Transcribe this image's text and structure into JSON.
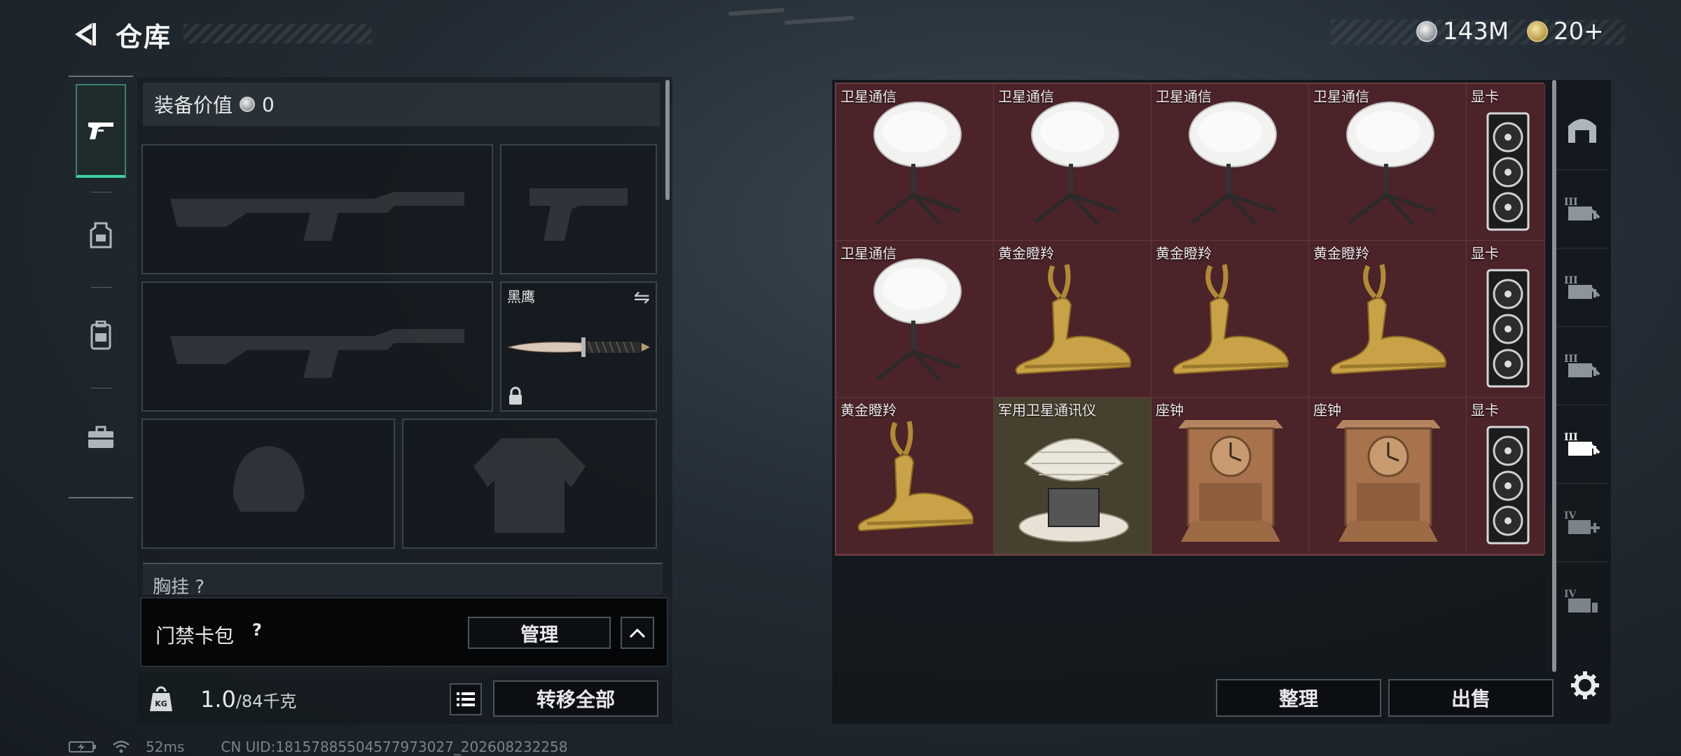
{
  "header": {
    "title": "仓库"
  },
  "currencies": [
    {
      "icon": "silver-coin-icon",
      "value": "143M"
    },
    {
      "icon": "gold-coin-icon",
      "value": "20+"
    }
  ],
  "left_tabs": [
    "gun-icon",
    "armor-icon",
    "backpack-icon",
    "briefcase-icon"
  ],
  "equipment": {
    "value_label": "装备价值",
    "value": "0",
    "knife_slot_label": "黑鹰",
    "partial_row_label": "胸挂 ?"
  },
  "keycard": {
    "label": "门禁卡包",
    "help": "?",
    "manage_label": "管理"
  },
  "weight": {
    "current": "1.0",
    "capacity": "/84千克",
    "transfer_all_label": "转移全部"
  },
  "storage": {
    "items": [
      {
        "label": "卫星通信",
        "kind": "dish"
      },
      {
        "label": "卫星通信",
        "kind": "dish"
      },
      {
        "label": "卫星通信",
        "kind": "dish"
      },
      {
        "label": "卫星通信",
        "kind": "dish"
      },
      {
        "label": "显卡",
        "kind": "gpu"
      },
      {
        "label": "卫星通信",
        "kind": "dish"
      },
      {
        "label": "黄金瞪羚",
        "kind": "gazelle"
      },
      {
        "label": "黄金瞪羚",
        "kind": "gazelle"
      },
      {
        "label": "黄金瞪羚",
        "kind": "gazelle"
      },
      {
        "label": "显卡",
        "kind": "gpu"
      },
      {
        "label": "黄金瞪羚",
        "kind": "gazelle"
      },
      {
        "label": "军用卫星通讯仪",
        "kind": "military"
      },
      {
        "label": "座钟",
        "kind": "clock"
      },
      {
        "label": "座钟",
        "kind": "clock"
      },
      {
        "label": "显卡",
        "kind": "gpu"
      }
    ],
    "sort_label": "整理",
    "sell_label": "出售"
  },
  "right_tabs": [
    "storage-home-icon",
    "storage-3-icon",
    "storage-3-icon",
    "storage-3-icon",
    "storage-3-active-icon",
    "storage-4-add-icon",
    "storage-4-icon"
  ],
  "status": {
    "ping": "52ms",
    "uid": "CN UID:18157885504577973027_202608232258"
  },
  "colors": {
    "accent": "#3bd1a0",
    "cell_red": "#4b2329",
    "cell_brown": "#46402f"
  }
}
